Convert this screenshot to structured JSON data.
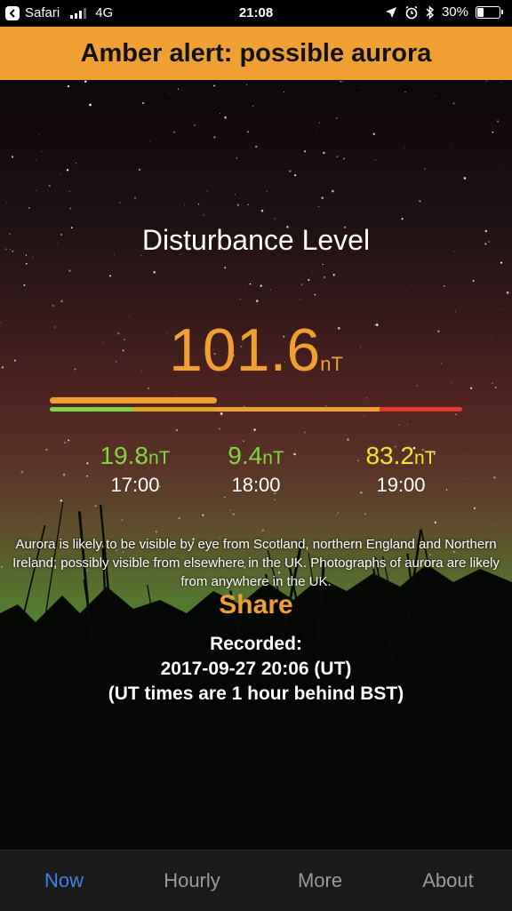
{
  "status_bar": {
    "back_app": "Safari",
    "network": "4G",
    "time": "21:08",
    "battery": "30%",
    "battery_level": 0.3,
    "icons": [
      "location-arrow-icon",
      "alarm-icon",
      "bluetooth-icon"
    ]
  },
  "alert": {
    "text": "Amber alert: possible aurora",
    "color": "#f0a033"
  },
  "main": {
    "title": "Disturbance Level",
    "value": "101.6",
    "unit": "nT",
    "level_fraction": 0.405,
    "scale_colors": [
      "#7fd640",
      "#d7a620",
      "#f0a033",
      "#e23a2a"
    ],
    "history": [
      {
        "value": "19.8",
        "unit": "nT",
        "time": "17:00",
        "color": "#7fd640"
      },
      {
        "value": "9.4",
        "unit": "nT",
        "time": "18:00",
        "color": "#7fd640"
      },
      {
        "value": "83.2",
        "unit": "nT",
        "time": "19:00",
        "color": "#f2e23a"
      }
    ],
    "description": "Aurora is likely to be visible by eye from Scotland, northern England and Northern Ireland; possibly visible from elsewhere in the UK. Photographs of aurora are likely from anywhere in the UK.",
    "share_label": "Share",
    "recorded_label": "Recorded:",
    "recorded_time": "2017-09-27 20:06 (UT)",
    "recorded_note": "(UT times are 1 hour behind BST)"
  },
  "tabs": [
    {
      "label": "Now",
      "active": true
    },
    {
      "label": "Hourly",
      "active": false
    },
    {
      "label": "More",
      "active": false
    },
    {
      "label": "About",
      "active": false
    }
  ]
}
